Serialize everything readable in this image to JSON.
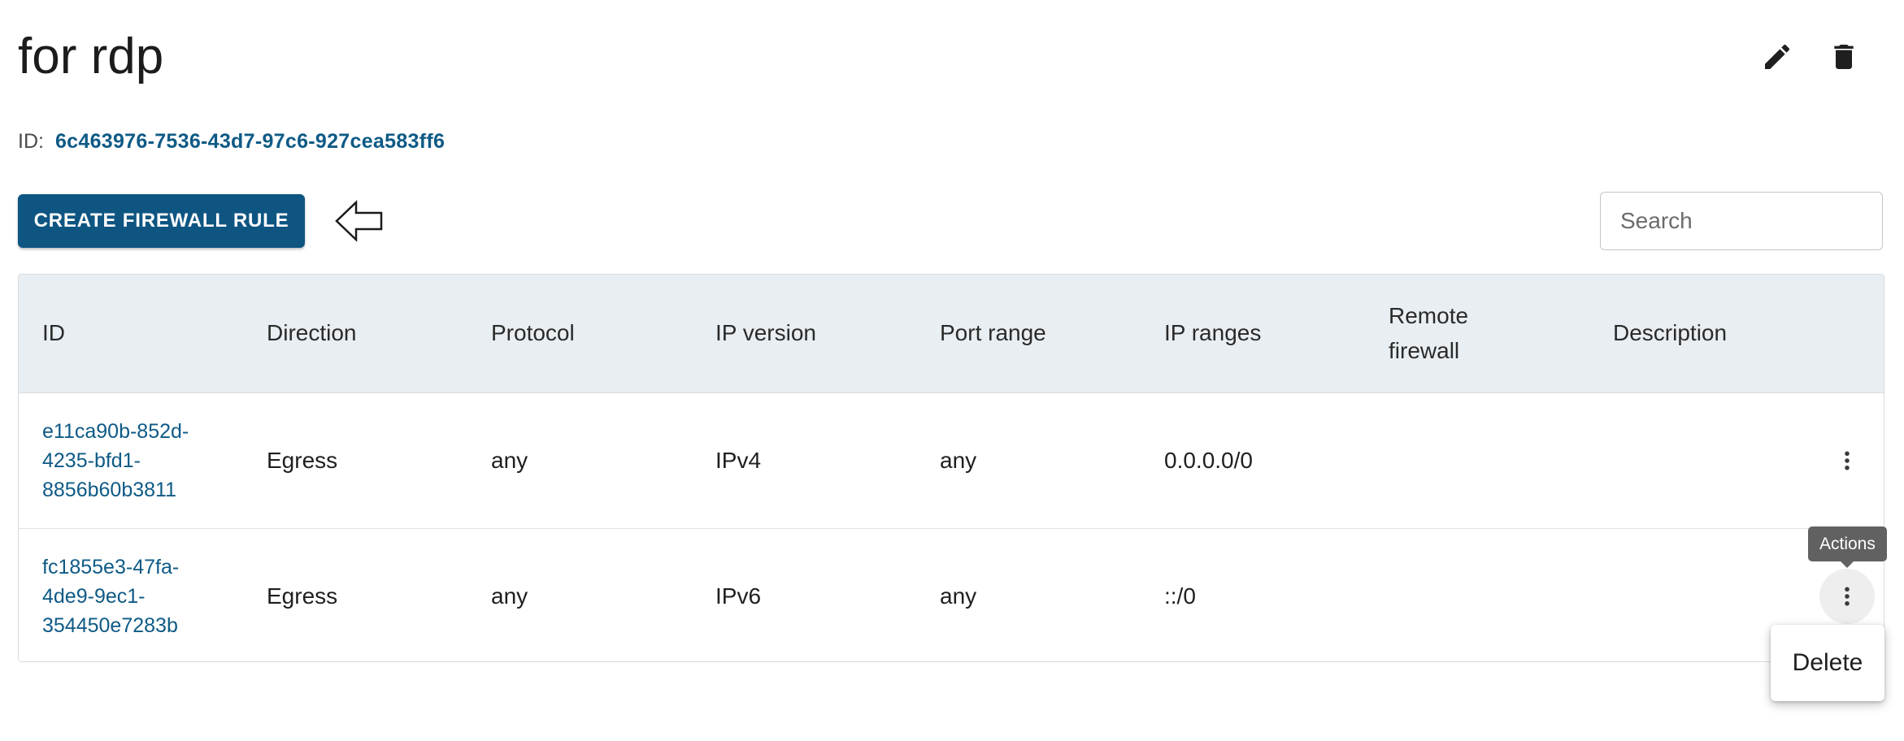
{
  "page": {
    "title": "for rdp",
    "id_label": "ID:",
    "id_value": "6c463976-7536-43d7-97c6-927cea583ff6"
  },
  "toolbar": {
    "create_label": "CREATE FIREWALL RULE",
    "search_placeholder": "Search"
  },
  "icons": {
    "edit": "pencil-icon",
    "delete": "trash-icon",
    "pointer": "arrow-left-outline-icon",
    "row_actions": "more-vert-icon"
  },
  "table": {
    "columns": [
      "ID",
      "Direction",
      "Protocol",
      "IP version",
      "Port range",
      "IP ranges",
      "Remote firewall",
      "Description"
    ],
    "rows": [
      {
        "id_lines": [
          "e11ca90b-852d-",
          "4235-bfd1-",
          "8856b60b3811"
        ],
        "direction": "Egress",
        "protocol": "any",
        "ip_version": "IPv4",
        "port_range": "any",
        "ip_ranges": "0.0.0.0/0",
        "remote_firewall": "",
        "description": ""
      },
      {
        "id_lines": [
          "fc1855e3-47fa-",
          "4de9-9ec1-",
          "354450e7283b"
        ],
        "direction": "Egress",
        "protocol": "any",
        "ip_version": "IPv6",
        "port_range": "any",
        "ip_ranges": "::/0",
        "remote_firewall": "",
        "description": ""
      }
    ]
  },
  "tooltip": "Actions",
  "menu": {
    "delete_label": "Delete"
  },
  "colors": {
    "primary": "#0e5582",
    "link": "#0e5a86",
    "header_bg": "#e9eef2",
    "tooltip_bg": "#616161"
  }
}
